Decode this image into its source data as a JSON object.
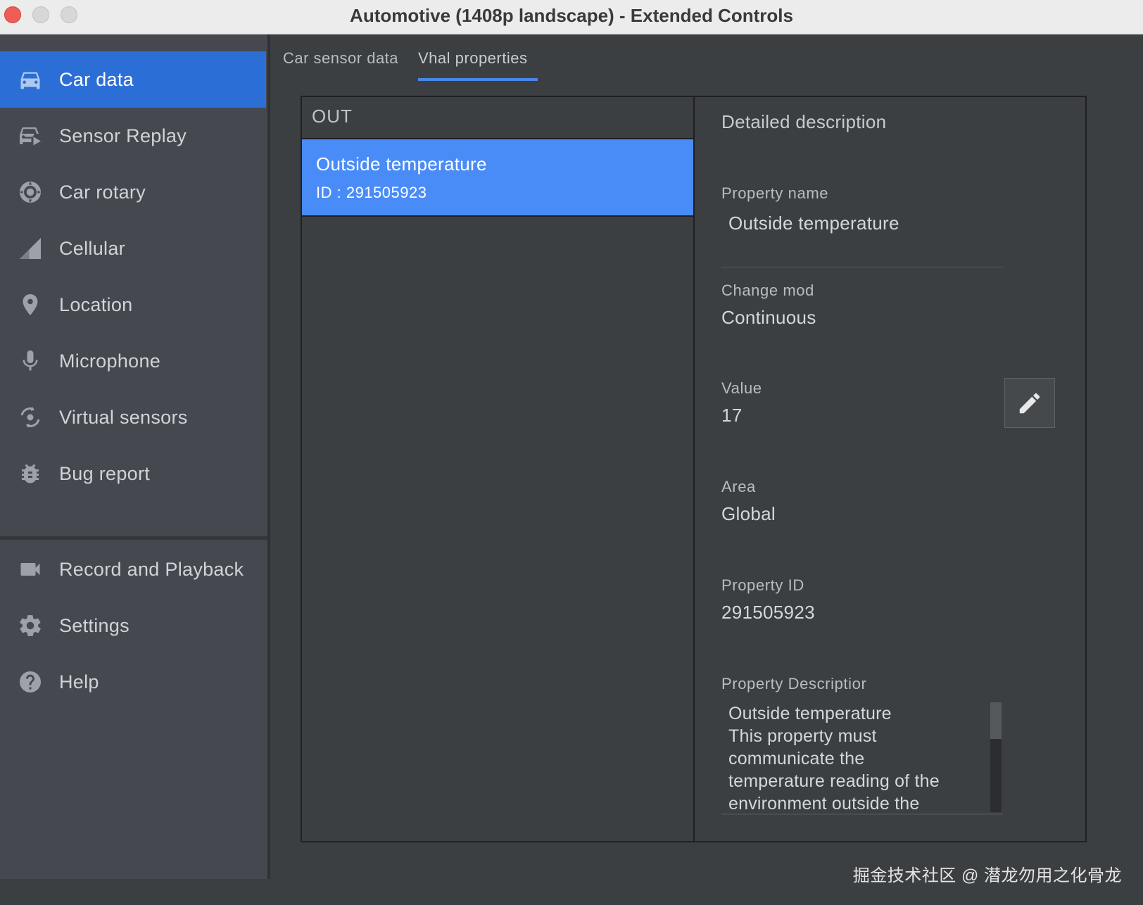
{
  "window": {
    "title": "Automotive (1408p landscape) - Extended Controls"
  },
  "sidebar": {
    "items": [
      {
        "label": "Car data",
        "icon": "car-icon",
        "active": true
      },
      {
        "label": "Sensor Replay",
        "icon": "sensor-replay-icon",
        "active": false
      },
      {
        "label": "Car rotary",
        "icon": "rotary-icon",
        "active": false
      },
      {
        "label": "Cellular",
        "icon": "cellular-signal-icon",
        "active": false
      },
      {
        "label": "Location",
        "icon": "location-pin-icon",
        "active": false
      },
      {
        "label": "Microphone",
        "icon": "microphone-icon",
        "active": false
      },
      {
        "label": "Virtual sensors",
        "icon": "virtual-sensors-icon",
        "active": false
      },
      {
        "label": "Bug report",
        "icon": "bug-icon",
        "active": false
      },
      {
        "label": "Record and Playback",
        "icon": "video-camera-icon",
        "active": false
      },
      {
        "label": "Settings",
        "icon": "gear-icon",
        "active": false
      },
      {
        "label": "Help",
        "icon": "help-icon",
        "active": false
      }
    ]
  },
  "tabs": [
    {
      "label": "Car sensor data",
      "active": false
    },
    {
      "label": "Vhal properties",
      "active": true
    }
  ],
  "list": {
    "header": "OUT",
    "items": [
      {
        "title": "Outside temperature",
        "id_text": "ID : 291505923",
        "selected": true
      }
    ]
  },
  "detail": {
    "heading": "Detailed description",
    "property_name_label": "Property name",
    "property_name_value": "Outside temperature",
    "change_mode_label": "Change mod",
    "change_mode_value": "Continuous",
    "value_label": "Value",
    "value_value": "17",
    "area_label": "Area",
    "area_value": "Global",
    "property_id_label": "Property ID",
    "property_id_value": "291505923",
    "property_description_label": "Property Descriptior",
    "property_description_value": "Outside temperature\nThis property must\ncommunicate the\ntemperature reading of the\nenvironment outside the"
  },
  "watermark": "掘金技术社区 @ 潜龙勿用之化骨龙",
  "colors": {
    "accent_active": "#2b6fd6",
    "list_selected": "#4a8cf7",
    "background": "#3c3f41",
    "sidebar": "#45484f"
  }
}
